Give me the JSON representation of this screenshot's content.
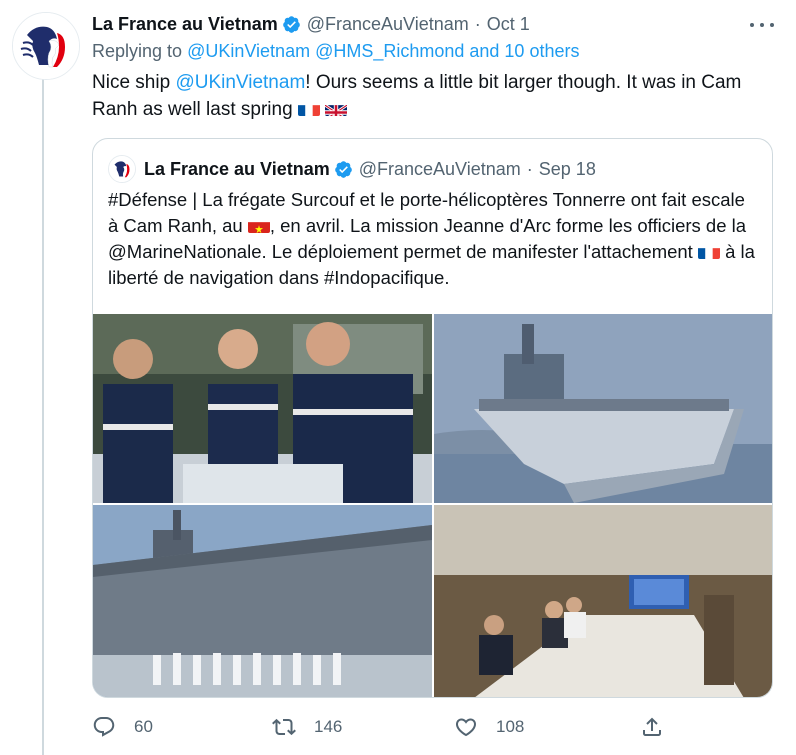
{
  "tweet": {
    "display_name": "La France au Vietnam",
    "handle": "@FranceAuVietnam",
    "separator": "·",
    "date": "Oct 1",
    "replying_prefix": "Replying to",
    "replying_to": "@UKinVietnam @HMS_Richmond and 10 others",
    "text_part1": "Nice ship",
    "text_mention": "@UKinVietnam",
    "text_part2": "! Ours seems a little bit larger though. It was in Cam Ranh as well last spring"
  },
  "quoted": {
    "display_name": "La France au Vietnam",
    "handle": "@FranceAuVietnam",
    "separator": "·",
    "date": "Sep 18",
    "line1": "#Défense | La frégate Surcouf et le porte-hélicoptères Tonnerre ont fait escale à Cam Ranh, au",
    "line2": ", en avril. La mission Jeanne d'Arc forme les officiers de la @MarineNationale. Le déploiement permet de manifester l'attachement",
    "line3": "à la liberté de navigation dans #Indopacifique."
  },
  "actions": {
    "replies": "60",
    "retweets": "146",
    "likes": "108"
  },
  "colors": {
    "accent": "#1d9bf0",
    "muted": "#536471",
    "verified": "#1d9bf0"
  },
  "icons": [
    "verified-badge-icon",
    "more-icon",
    "reply-icon",
    "retweet-icon",
    "like-icon",
    "share-icon"
  ]
}
